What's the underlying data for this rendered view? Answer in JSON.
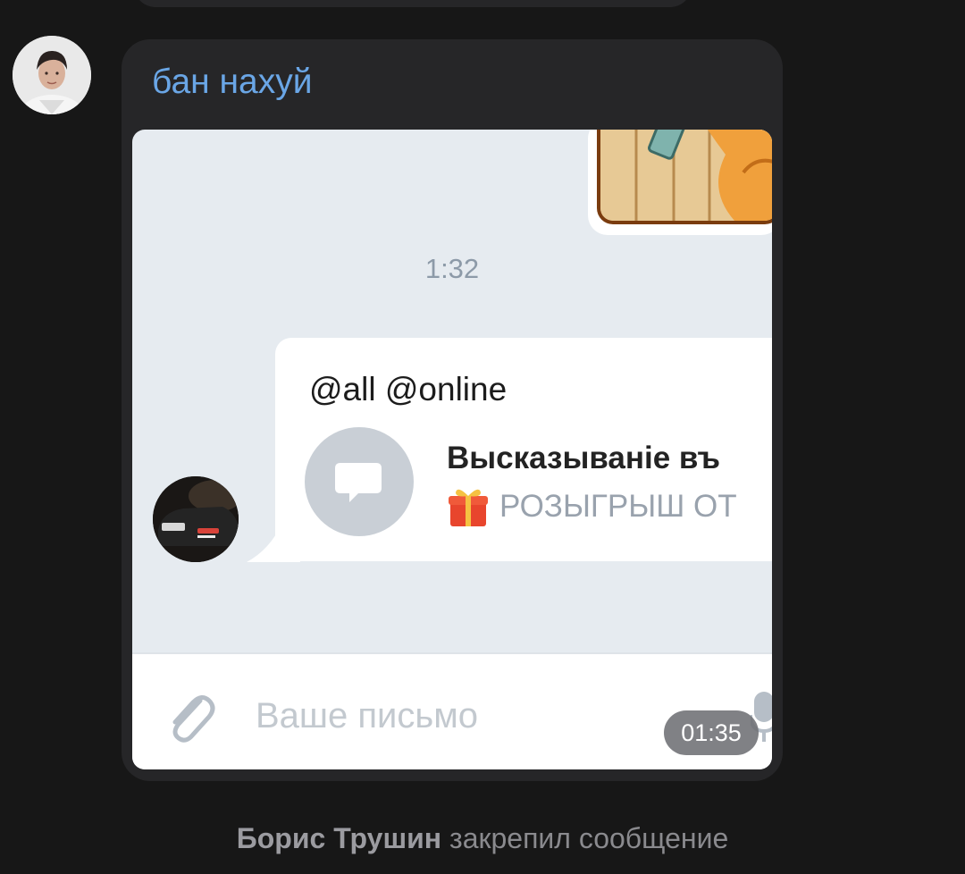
{
  "message": {
    "text": "бан нахуй"
  },
  "screenshot": {
    "time_divider": "1:32",
    "forwarded": {
      "mentions": "@all @online",
      "attachment_title": "Высказываніе въ",
      "attachment_subtitle": "РОЗЫГРЫШ ОТ"
    },
    "compose": {
      "placeholder": "Ваше письмо"
    }
  },
  "video_duration": "01:35",
  "service_message": {
    "actor": "Борис Трушин",
    "action": "закрепил сообщение"
  },
  "colors": {
    "background": "#171717",
    "bubble": "#262628",
    "link_text": "#6aa6e6",
    "chat_background": "#e6ebf0"
  }
}
